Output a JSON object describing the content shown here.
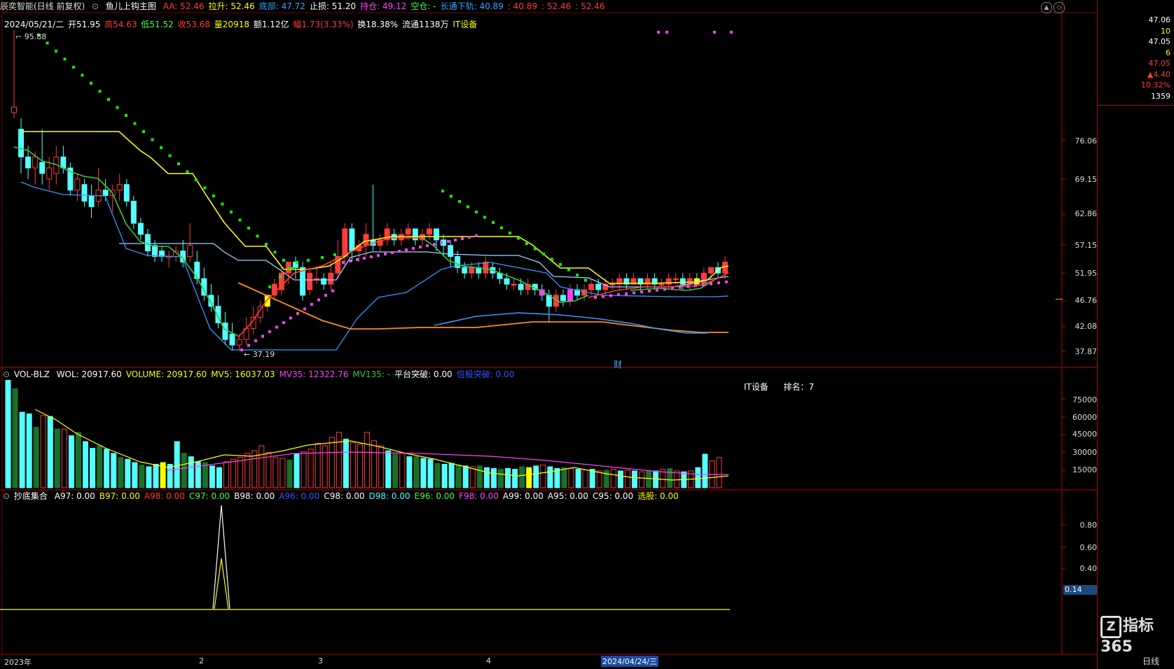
{
  "main_header": {
    "stock": "辰奕智能(日线 前复权)",
    "indicator": "鱼儿上钩主图",
    "items": [
      {
        "label": "AA: 52.46",
        "color": "#ff3b3b"
      },
      {
        "label": "拉升: 52.46",
        "color": "#ffff00"
      },
      {
        "label": "底部: 47.72",
        "color": "#2fa6ff"
      },
      {
        "label": "止损: 51.20",
        "color": "#ffffff"
      },
      {
        "label": "持仓: 49.12",
        "color": "#ff40ff"
      },
      {
        "label": "空仓: -",
        "color": "#40ff40"
      },
      {
        "label": "长通下轨: 40.89",
        "color": "#2fa6ff"
      },
      {
        "label": ": 40.89",
        "color": "#ff3b3b"
      },
      {
        "label": ": 52.46",
        "color": "#ff3b3b"
      },
      {
        "label": ": 52.46",
        "color": "#ff3b3b"
      }
    ]
  },
  "quote": {
    "date": "2024/05/21/二",
    "open": "开51.95",
    "high": "高54.63",
    "low": "低51.52",
    "close": "收53.68",
    "vol": "量20918",
    "amount": "额1.12亿",
    "change": "幅1.73(3.33%)",
    "turnover": "换18.38%",
    "float": "流通1138万",
    "sector": "IT设备"
  },
  "main_labels": {
    "high_mark": "95.88",
    "low_mark": "37.19",
    "fin_mark": "财"
  },
  "main_yaxis": [
    "76.06",
    "69.15",
    "62.86",
    "57.15",
    "51.95",
    "46.76",
    "42.08",
    "37.87"
  ],
  "vol_header": {
    "name": "VOL-BLZ",
    "items": [
      {
        "label": "WOL: 20917.60",
        "color": "#ffffff"
      },
      {
        "label": "VOLUME: 20917.60",
        "color": "#ffff00"
      },
      {
        "label": "MV5: 16037.03",
        "color": "#ffff00"
      },
      {
        "label": "MV35: 12322.76",
        "color": "#ff40ff"
      },
      {
        "label": "MV135: -",
        "color": "#40c040"
      },
      {
        "label": "平台突破: 0.00",
        "color": "#ffffff"
      },
      {
        "label": "倍股突破: 0.00",
        "color": "#3355ff"
      }
    ],
    "rank_sector": "IT设备",
    "rank": "排名：7"
  },
  "vol_yaxis": [
    "75000",
    "60000",
    "45000",
    "30000",
    "15000"
  ],
  "ind_header": {
    "name": "抄底集合",
    "items": [
      {
        "label": "A97: 0.00",
        "color": "#ffffff"
      },
      {
        "label": "B97: 0.00",
        "color": "#ffff00"
      },
      {
        "label": "A98: 0.00",
        "color": "#ff3b3b"
      },
      {
        "label": "C97: 0.00",
        "color": "#40ff40"
      },
      {
        "label": "B98: 0.00",
        "color": "#ffffff"
      },
      {
        "label": "A96: 0.00",
        "color": "#3355ff"
      },
      {
        "label": "C98: 0.00",
        "color": "#ffffff"
      },
      {
        "label": "D98: 0.00",
        "color": "#40ffff"
      },
      {
        "label": "E96: 0.00",
        "color": "#40ff40"
      },
      {
        "label": "F98: 0.00",
        "color": "#ff40ff"
      },
      {
        "label": "A99: 0.00",
        "color": "#ffffff"
      },
      {
        "label": "A95: 0.00",
        "color": "#ffffff"
      },
      {
        "label": "C95: 0.00",
        "color": "#ffffff"
      },
      {
        "label": "选股: 0.00",
        "color": "#ffff00"
      }
    ]
  },
  "ind_yaxis": [
    "0.80",
    "0.60",
    "0.40"
  ],
  "ind_current": "0.14",
  "xaxis": {
    "year": "2023年",
    "m2": "2",
    "m3": "3",
    "m4": "4",
    "cursor_date": "2024/04/24/三"
  },
  "right_panel": {
    "top_values": [
      {
        "v": "47.06",
        "c": "#ffffff"
      },
      {
        "v": "10",
        "c": "#ffff00"
      },
      {
        "v": "47.05",
        "c": "#ffffff"
      },
      {
        "v": "6",
        "c": "#ffff00"
      },
      {
        "v": "47.05",
        "c": "#ff3b3b"
      },
      {
        "v": "▲4.40",
        "c": "#ff3b3b"
      },
      {
        "v": "10.32%",
        "c": "#ff3b3b"
      },
      {
        "v": "1359",
        "c": "#ffffff"
      }
    ],
    "period": "日线",
    "logo": "指标365"
  },
  "colors": {
    "up": "#ff3b3b",
    "down": "#54ffff",
    "bg": "#000000",
    "grid": "#7a0000"
  }
}
